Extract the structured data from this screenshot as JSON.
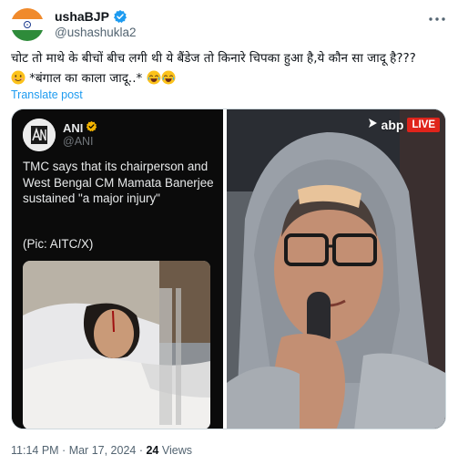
{
  "author": {
    "display_name": "ushaBJP",
    "handle": "@ushashukla2",
    "avatar_icon": "india-flag-avatar",
    "verified_icon": "verified-badge-icon",
    "verified_color": "#1d9bf0"
  },
  "more_icon": "more-options-icon",
  "tweet": {
    "line1": "चोट तो माथे के बीचों बीच लगी थी ये बैंडेज तो किनारे चिपका हुआ है,ये कौन सा जादू है???",
    "line2_emoji_start": "smiling-face-emoji",
    "line2_text": " *बंगाल का काला जादू..* ",
    "line2_emojis_end": [
      "joy-emoji",
      "joy-emoji"
    ]
  },
  "translate_label": "Translate post",
  "media": {
    "left": {
      "source_name": "ANI",
      "source_handle": "@ANI",
      "source_verified_color": "#f4b400",
      "body": "TMC says that its chairperson and West Bengal CM Mamata Banerjee sustained \"a major injury\"",
      "pic_credit": "(Pic: AITC/X)"
    },
    "right": {
      "channel": "abp",
      "live_label": "LIVE",
      "live_color": "#e0241b"
    }
  },
  "meta": {
    "time": "11:14 PM",
    "separator": " · ",
    "date": "Mar 17, 2024",
    "views_count": "24",
    "views_label": " Views"
  },
  "colors": {
    "accent": "#1d9bf0",
    "secondary_text": "#536471",
    "primary_text": "#0f1419"
  }
}
